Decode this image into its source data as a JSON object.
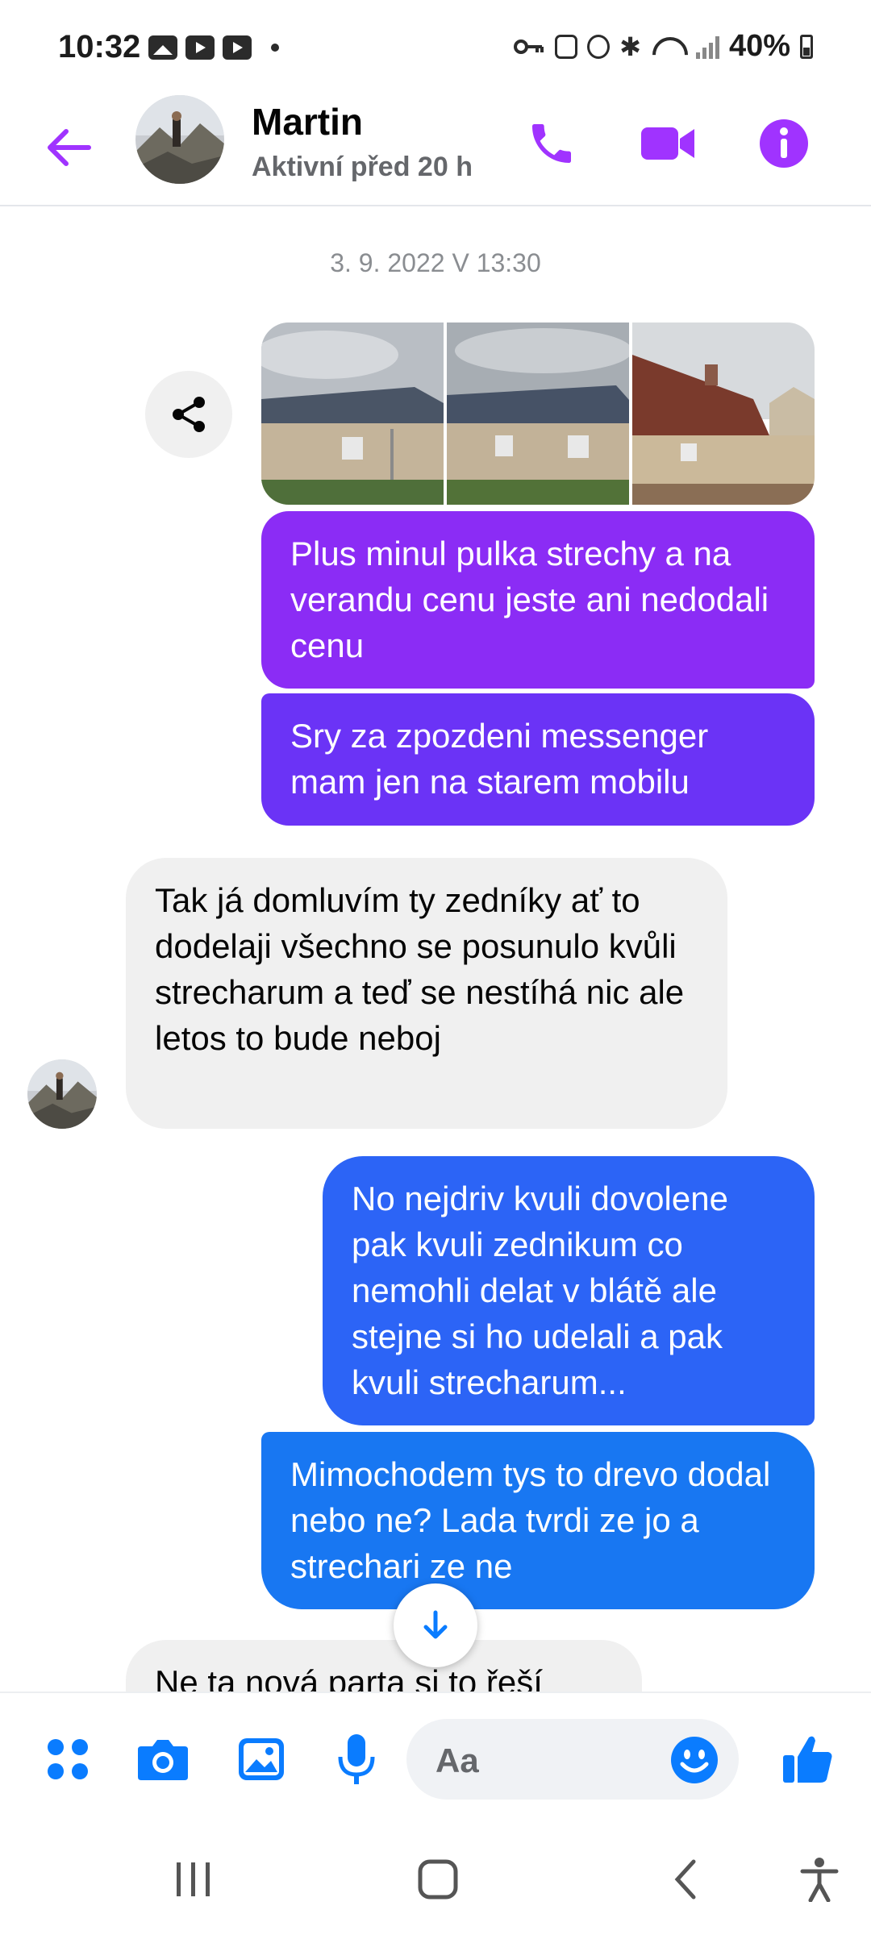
{
  "status_bar": {
    "time": "10:32",
    "battery": "40%"
  },
  "header": {
    "contact_name": "Martin",
    "contact_status": "Aktivní před 20 h",
    "accent_color": "#a033ff"
  },
  "thread": {
    "timestamp": "3. 9. 2022 V 13:30",
    "messages": [
      {
        "direction": "out",
        "text": "Plus minul pulka strechy a na verandu cenu jeste ani nedodali cenu"
      },
      {
        "direction": "out",
        "text": "Sry za zpozdeni messenger mam jen na starem mobilu"
      },
      {
        "direction": "in",
        "text": "Tak já domluvím ty zedníky ať to dodelaji všechno se posunulo kvůli strecharum a teď se nestíhá nic ale letos to bude neboj"
      },
      {
        "direction": "out",
        "text": "No nejdriv kvuli dovolene pak kvuli zednikum co nemohli delat v blátě ale stejne si ho udelali a pak kvuli strecharum..."
      },
      {
        "direction": "out",
        "text": "Mimochodem tys to drevo dodal nebo ne? Lada tvrdi ze jo a strechari ze ne"
      },
      {
        "direction": "in",
        "text": "Ne ta nová parta si to řeší"
      }
    ]
  },
  "composer": {
    "placeholder": "Aa"
  },
  "colors": {
    "bubble_purple": "#8b2cf5",
    "bubble_violet": "#6b33f6",
    "bubble_blue": "#2c64f6",
    "bubble_azure": "#1877f2",
    "messenger_blue": "#0a7cff"
  }
}
